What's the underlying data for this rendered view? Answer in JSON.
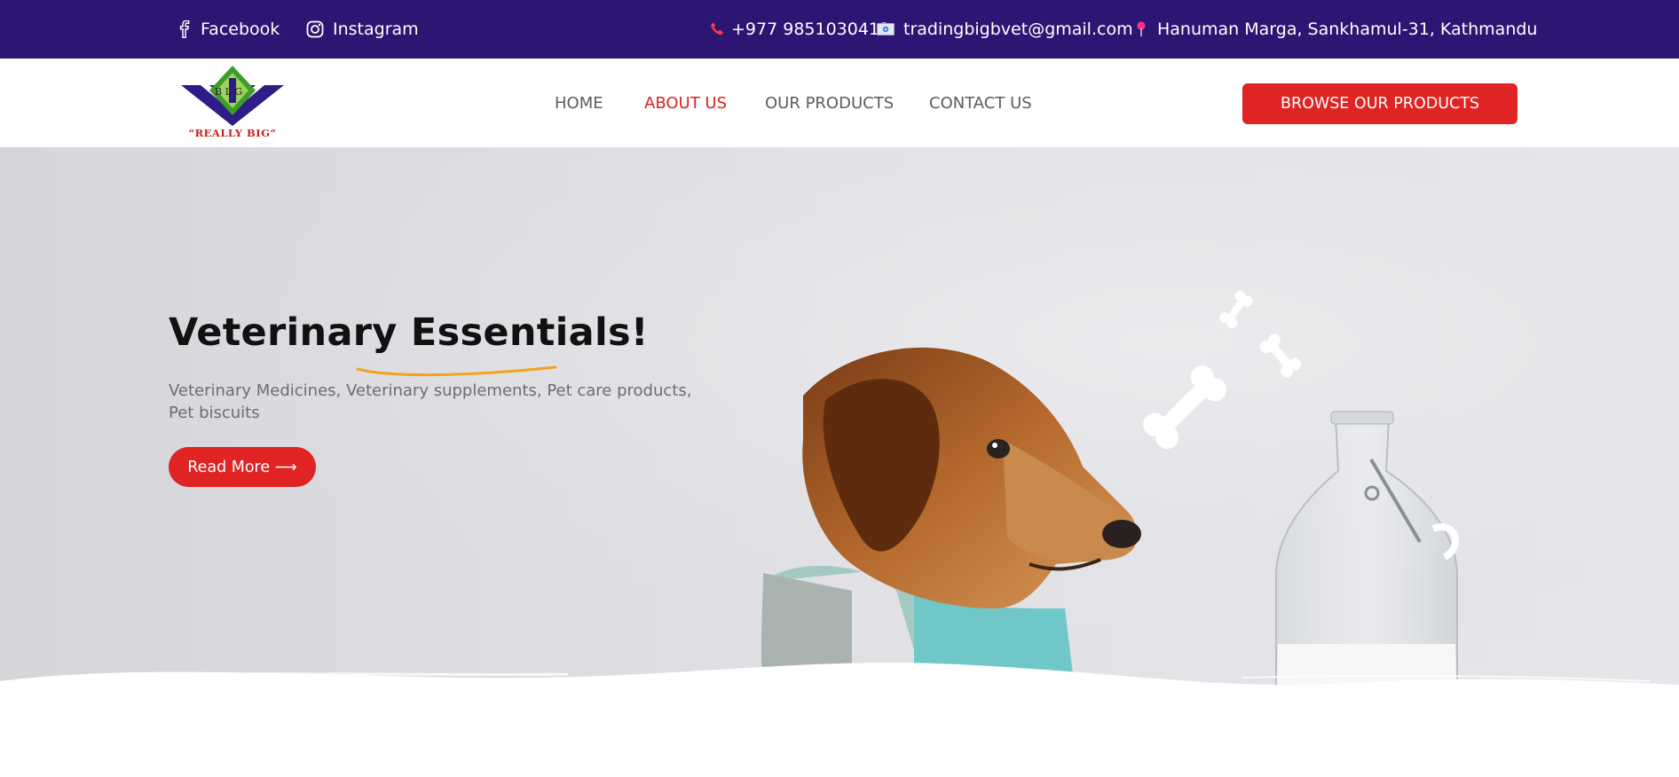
{
  "topbar": {
    "facebook_label": "Facebook",
    "instagram_label": "Instagram",
    "phone": "+977 9851030412",
    "email": "tradingbigbvet@gmail.com",
    "address": "Hanuman Marga, Sankhamul-31, Kathmandu",
    "icons": [
      "facebook-icon",
      "instagram-icon",
      "phone-icon",
      "email-icon",
      "location-pin-icon"
    ]
  },
  "logo": {
    "initials": "B L G",
    "tagline": "“REALLY BIG”"
  },
  "nav": {
    "items": [
      {
        "label": "HOME",
        "active": false
      },
      {
        "label": "ABOUT US",
        "active": true
      },
      {
        "label": "OUR PRODUCTS",
        "active": false
      },
      {
        "label": "CONTACT US",
        "active": false
      }
    ]
  },
  "header": {
    "cta_label": "BROWSE OUR PRODUCTS"
  },
  "hero": {
    "title": "Veterinary Essentials!",
    "subtitle": "Veterinary Medicines, Veterinary supplements, Pet care products, Pet biscuits",
    "button_label": "Read More ⟶"
  },
  "colors": {
    "topbar_bg": "#2d1573",
    "accent_red": "#e02323",
    "nav_text": "#5b5b62",
    "underline_orange": "#f2a31b"
  }
}
